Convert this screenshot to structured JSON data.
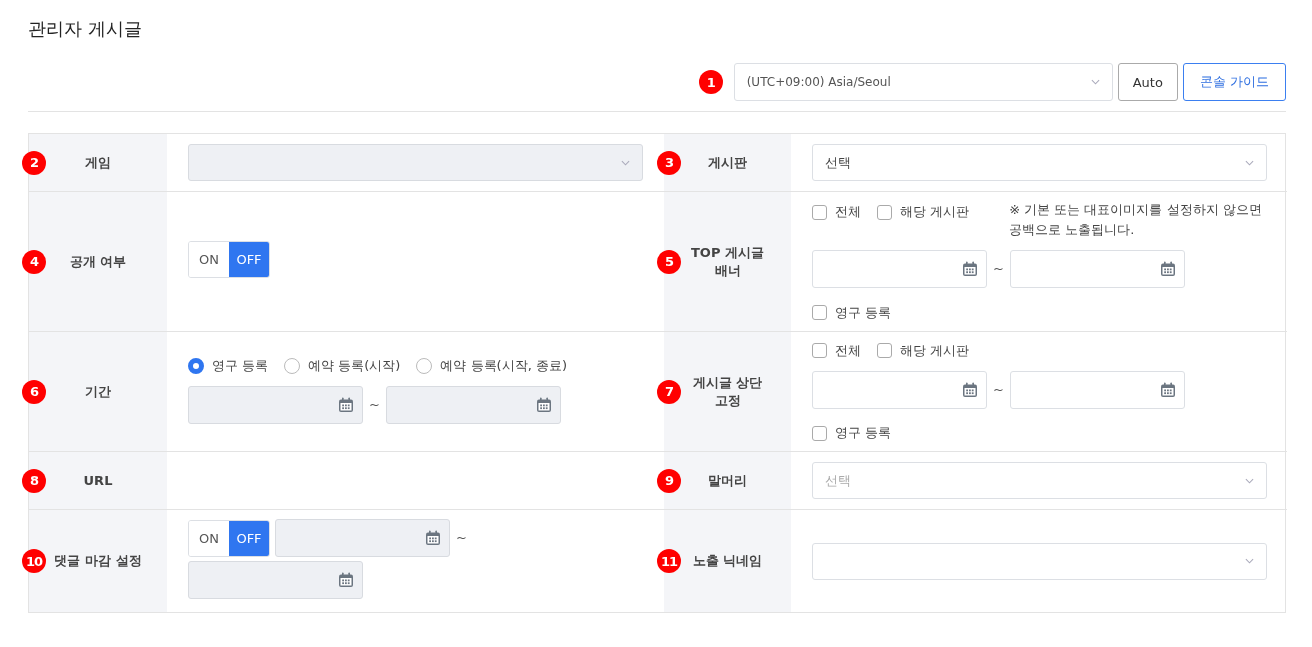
{
  "page_title": "관리자 게시글",
  "toolbar": {
    "badge": "1",
    "timezone": {
      "value": "(UTC+09:00) Asia/Seoul"
    },
    "buttons": [
      {
        "label": "Auto",
        "kind": "default"
      },
      {
        "label": "콘솔 가이드",
        "kind": "primary"
      }
    ]
  },
  "rows": [
    {
      "cells": [
        {
          "badge": "2",
          "label": "게임",
          "lines": [
            [
              {
                "kind": "select",
                "disabled": true
              }
            ]
          ]
        },
        {
          "badge": "3",
          "label": "게시판",
          "lines": [
            [
              {
                "kind": "select",
                "value": "선택"
              }
            ]
          ]
        }
      ]
    },
    {
      "cells": [
        {
          "badge": "4",
          "label": "공개 여부",
          "lines": [
            [
              {
                "kind": "toggle",
                "options": [
                  {
                    "label": "ON",
                    "selected": false
                  },
                  {
                    "label": "OFF",
                    "selected": true
                  }
                ]
              }
            ]
          ]
        },
        {
          "badge": "5",
          "label": "TOP 게시글 배너",
          "lines": [
            [
              {
                "kind": "checkbox",
                "label": "전체",
                "checked": false
              },
              {
                "kind": "checkbox",
                "label": "해당 게시판",
                "checked": false
              },
              {
                "kind": "note",
                "text": "※ 기본 또는 대표이미지를 설정하지 않으면 공백으로 노출됩니다."
              }
            ],
            [
              {
                "kind": "date"
              },
              {
                "kind": "separator",
                "text": "~"
              },
              {
                "kind": "date"
              }
            ],
            [
              {
                "kind": "checkbox",
                "label": "영구 등록",
                "checked": false
              }
            ]
          ]
        }
      ]
    },
    {
      "cells": [
        {
          "badge": "6",
          "label": "기간",
          "lines": [
            [
              {
                "kind": "radio",
                "label": "영구 등록",
                "selected": true
              },
              {
                "kind": "radio",
                "label": "예약 등록(시작)",
                "selected": false
              },
              {
                "kind": "radio",
                "label": "예약 등록(시작, 종료)",
                "selected": false
              }
            ],
            [
              {
                "kind": "date",
                "disabled": true
              },
              {
                "kind": "separator",
                "text": "~"
              },
              {
                "kind": "date",
                "disabled": true
              }
            ]
          ]
        },
        {
          "badge": "7",
          "label": "게시글 상단 고정",
          "lines": [
            [
              {
                "kind": "checkbox",
                "label": "전체",
                "checked": false
              },
              {
                "kind": "checkbox",
                "label": "해당 게시판",
                "checked": false
              }
            ],
            [
              {
                "kind": "date"
              },
              {
                "kind": "separator",
                "text": "~"
              },
              {
                "kind": "date"
              }
            ],
            [
              {
                "kind": "checkbox",
                "label": "영구 등록",
                "checked": false
              }
            ]
          ]
        }
      ]
    },
    {
      "cells": [
        {
          "badge": "8",
          "label": "URL"
        },
        {
          "badge": "9",
          "label": "말머리",
          "lines": [
            [
              {
                "kind": "select",
                "placeholder": "선택"
              }
            ]
          ]
        }
      ]
    },
    {
      "cells": [
        {
          "badge": "10",
          "label": "댓글 마감 설정",
          "lines": [
            [
              {
                "kind": "toggle",
                "options": [
                  {
                    "label": "ON",
                    "selected": false
                  },
                  {
                    "label": "OFF",
                    "selected": true
                  }
                ]
              },
              {
                "kind": "date",
                "disabled": true
              },
              {
                "kind": "separator",
                "text": "~"
              },
              {
                "kind": "date",
                "disabled": true
              }
            ]
          ]
        },
        {
          "badge": "11",
          "label": "노출 닉네임",
          "lines": [
            [
              {
                "kind": "select"
              }
            ]
          ]
        }
      ]
    }
  ]
}
